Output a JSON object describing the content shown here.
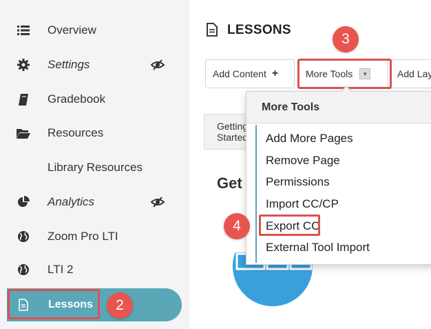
{
  "sidebar": {
    "items": [
      {
        "label": "Overview",
        "icon": "list-icon"
      },
      {
        "label": "Settings",
        "icon": "gear-icon",
        "hidden_icon": "eye-slash-icon"
      },
      {
        "label": "Gradebook",
        "icon": "book-icon"
      },
      {
        "label": "Resources",
        "icon": "folder-open-icon"
      },
      {
        "label": "Library Resources",
        "icon": ""
      },
      {
        "label": "Analytics",
        "icon": "pie-chart-icon",
        "hidden_icon": "eye-slash-icon"
      },
      {
        "label": "Zoom Pro LTI",
        "icon": "globe-icon"
      },
      {
        "label": "LTI 2",
        "icon": "globe-icon"
      },
      {
        "label": "Lessons",
        "icon": "document-icon",
        "active": true
      }
    ]
  },
  "main": {
    "title": "LESSONS",
    "toolbar": {
      "add_content": "Add Content",
      "add_content_icon": "+",
      "more_tools": "More Tools",
      "add_layout": "Add Layout"
    },
    "tab_partial": "Getting Started",
    "content_heading_partial": "Get"
  },
  "dropdown": {
    "header": "More Tools",
    "items": [
      "Add More Pages",
      "Remove Page",
      "Permissions",
      "Import CC/CP",
      "Export CC",
      "External Tool Import"
    ]
  },
  "steps": {
    "lessons": "2",
    "more_tools": "3",
    "export": "4"
  },
  "colors": {
    "accent": "#5aa7b8",
    "highlight": "#d9534f",
    "badge": "#e8554e",
    "illustration": "#3aa0dc"
  }
}
